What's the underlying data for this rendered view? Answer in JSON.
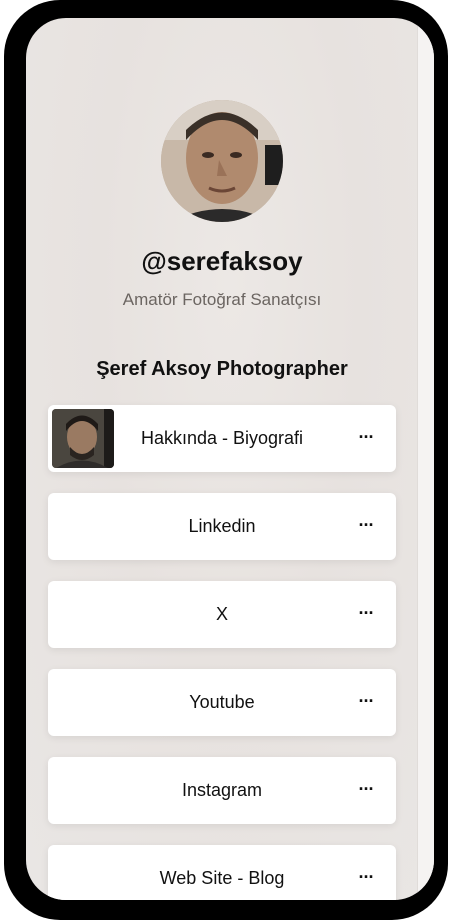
{
  "profile": {
    "username": "@serefaksoy",
    "bio": "Amatör Fotoğraf Sanatçısı",
    "section_title": "Şeref Aksoy Photographer"
  },
  "links": [
    {
      "label": "Hakkında - Biyografi",
      "has_thumbnail": true,
      "more_label": "···"
    },
    {
      "label": "Linkedin",
      "has_thumbnail": false,
      "more_label": "···"
    },
    {
      "label": "X",
      "has_thumbnail": false,
      "more_label": "···"
    },
    {
      "label": "Youtube",
      "has_thumbnail": false,
      "more_label": "···"
    },
    {
      "label": "Instagram",
      "has_thumbnail": false,
      "more_label": "···"
    },
    {
      "label": "Web Site - Blog",
      "has_thumbnail": false,
      "more_label": "···"
    }
  ],
  "colors": {
    "frame": "#000000",
    "background": "#e9e4e1",
    "card": "#ffffff",
    "text": "#111111",
    "muted_text": "#6b6561"
  }
}
